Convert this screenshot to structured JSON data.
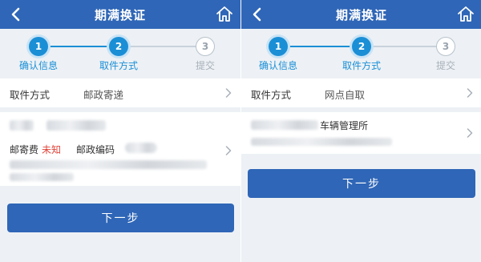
{
  "screens": [
    {
      "header": {
        "title": "期满换证"
      },
      "steps": [
        {
          "number": "1",
          "label": "确认信息",
          "state": "done"
        },
        {
          "number": "2",
          "label": "取件方式",
          "state": "current"
        },
        {
          "number": "3",
          "label": "提交",
          "state": "pending"
        }
      ],
      "pickup": {
        "label": "取件方式",
        "value": "邮政寄递"
      },
      "address": {
        "postage_label": "邮寄费",
        "postage_value": "未知",
        "postcode_label": "邮政编码"
      },
      "next_label": "下一步"
    },
    {
      "header": {
        "title": "期满换证"
      },
      "steps": [
        {
          "number": "1",
          "label": "确认信息",
          "state": "done"
        },
        {
          "number": "2",
          "label": "取件方式",
          "state": "current"
        },
        {
          "number": "3",
          "label": "提交",
          "state": "pending"
        }
      ],
      "pickup": {
        "label": "取件方式",
        "value": "网点自取"
      },
      "outlet": {
        "name_suffix": "车辆管理所"
      },
      "next_label": "下一步"
    }
  ],
  "colors": {
    "header_bg": "#2f66b7",
    "step_active": "#1b8fd6",
    "step_inactive": "#b7c1cb",
    "warning_text": "#e0443a",
    "button_bg": "#2f66b7"
  },
  "icons": {
    "back": "chevron-left-icon",
    "home": "home-icon",
    "row_arrow": "chevron-right-icon"
  }
}
